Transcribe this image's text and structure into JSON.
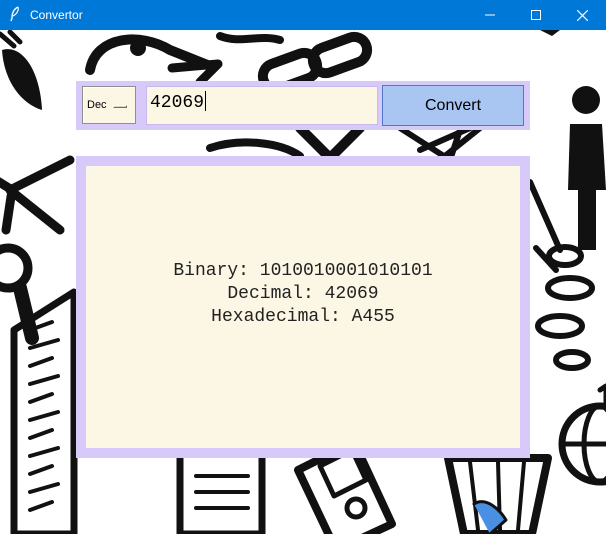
{
  "window": {
    "title": "Convertor",
    "icons": {
      "app": "feather-icon",
      "minimize": "minimize-icon",
      "maximize": "maximize-icon",
      "close": "close-icon"
    }
  },
  "controls": {
    "base_select": "Dec",
    "number_input": "42069",
    "convert_label": "Convert"
  },
  "result": {
    "binary": "Binary: 1010010001010101",
    "decimal": "Decimal: 42069",
    "hexadecimal": "Hexadecimal: A455"
  },
  "colors": {
    "titlebar": "#0078d7",
    "panel_border": "#d7c9f9",
    "panel_fill": "#fcf6e5",
    "convert_button": "#a9c5f2"
  }
}
